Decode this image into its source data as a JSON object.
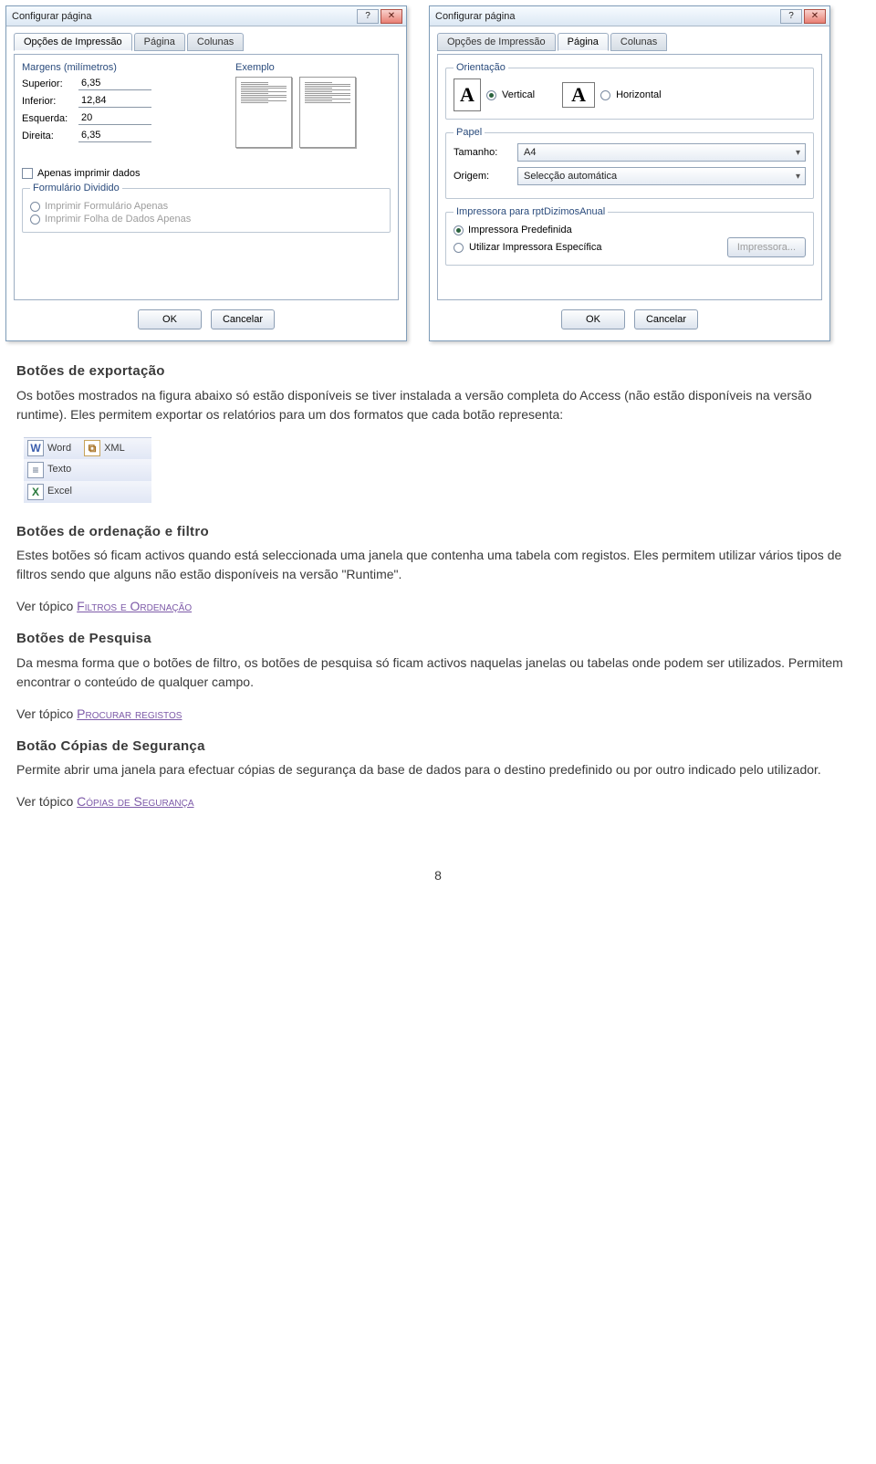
{
  "dialogs": {
    "left": {
      "title": "Configurar página",
      "tabs": [
        "Opções de Impressão",
        "Página",
        "Colunas"
      ],
      "active_tab": 0,
      "margins_legend": "Margens (milímetros)",
      "fields": {
        "superior_label": "Superior:",
        "superior_value": "6,35",
        "inferior_label": "Inferior:",
        "inferior_value": "12,84",
        "esquerda_label": "Esquerda:",
        "esquerda_value": "20",
        "direita_label": "Direita:",
        "direita_value": "6,35"
      },
      "example_label": "Exemplo",
      "only_data_label": "Apenas imprimir dados",
      "split_form_legend": "Formulário Dividido",
      "radio1": "Imprimir Formulário Apenas",
      "radio2": "Imprimir Folha de Dados Apenas",
      "ok": "OK",
      "cancel": "Cancelar"
    },
    "right": {
      "title": "Configurar página",
      "tabs": [
        "Opções de Impressão",
        "Página",
        "Colunas"
      ],
      "active_tab": 1,
      "orient_legend": "Orientação",
      "vertical_label": "Vertical",
      "horizontal_label": "Horizontal",
      "paper_legend": "Papel",
      "tamanho_label": "Tamanho:",
      "tamanho_value": "A4",
      "origem_label": "Origem:",
      "origem_value": "Selecção automática",
      "printer_legend": "Impressora para rptDizimosAnual",
      "radio_default": "Impressora Predefinida",
      "radio_specific": "Utilizar Impressora Específica",
      "printer_button": "Impressora...",
      "ok": "OK",
      "cancel": "Cancelar"
    }
  },
  "export": {
    "word": "Word",
    "xml": "XML",
    "texto": "Texto",
    "excel": "Excel"
  },
  "text": {
    "h1": "Botões de exportação",
    "p1": "Os botões mostrados na figura abaixo só estão disponíveis se tiver instalada a versão completa do Access (não estão disponíveis na versão runtime). Eles permitem exportar os relatórios para um dos formatos que cada botão representa:",
    "h2": "Botões de ordenação e filtro",
    "p2": "Estes botões só ficam activos quando está seleccionada uma janela que contenha uma tabela com registos. Eles permitem utilizar vários tipos de filtros sendo que alguns não estão disponíveis na versão \"Runtime\".",
    "see1_prefix": "Ver tópico ",
    "see1_link": "Filtros e Ordenação",
    "h3": "Botões de Pesquisa",
    "p3": "Da mesma forma que o botões de filtro, os botões de pesquisa só ficam activos naquelas janelas ou tabelas onde podem ser utilizados. Permitem encontrar o conteúdo de qualquer campo.",
    "see2_prefix": "Ver tópico ",
    "see2_link": "Procurar registos",
    "h4": "Botão Cópias de Segurança",
    "p4": "Permite abrir uma janela para efectuar cópias de segurança da base de dados para o destino predefinido ou por outro indicado pelo utilizador.",
    "see3_prefix": "Ver tópico ",
    "see3_link": "Cópias de Segurança",
    "page_number": "8"
  }
}
